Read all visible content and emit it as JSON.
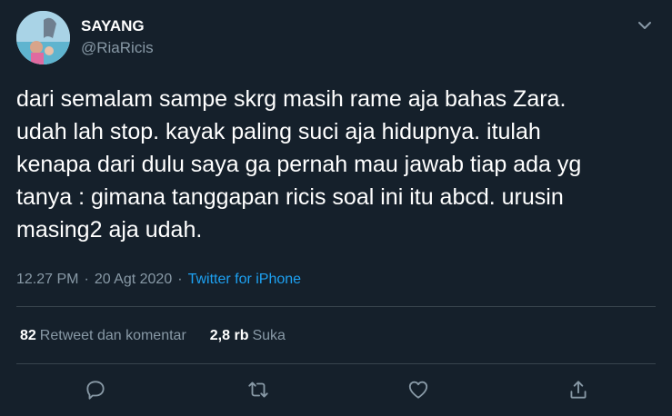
{
  "author": {
    "display_name": "SAYANG",
    "handle": "@RiaRicis"
  },
  "tweet": {
    "text": "dari semalam sampe skrg masih rame aja bahas Zara.\nudah lah stop. kayak paling suci aja hidupnya. itulah\nkenapa dari dulu saya ga pernah mau jawab tiap ada yg\ntanya : gimana tanggapan ricis soal ini itu abcd. urusin\nmasing2 aja udah.",
    "time": "12.27 PM",
    "date": "20 Agt 2020",
    "source": "Twitter for iPhone"
  },
  "stats": {
    "retweets_count": "82",
    "retweets_label": "Retweet dan komentar",
    "likes_count": "2,8 rb",
    "likes_label": "Suka"
  },
  "icons": {
    "reply": "speech-bubble-icon",
    "retweet": "retweet-icon",
    "like": "heart-icon",
    "share": "share-icon",
    "menu": "chevron-down-icon"
  },
  "colors": {
    "background": "#15202b",
    "text": "#ffffff",
    "muted": "#8899a6",
    "link": "#1da1f2",
    "divider": "#38444d"
  }
}
